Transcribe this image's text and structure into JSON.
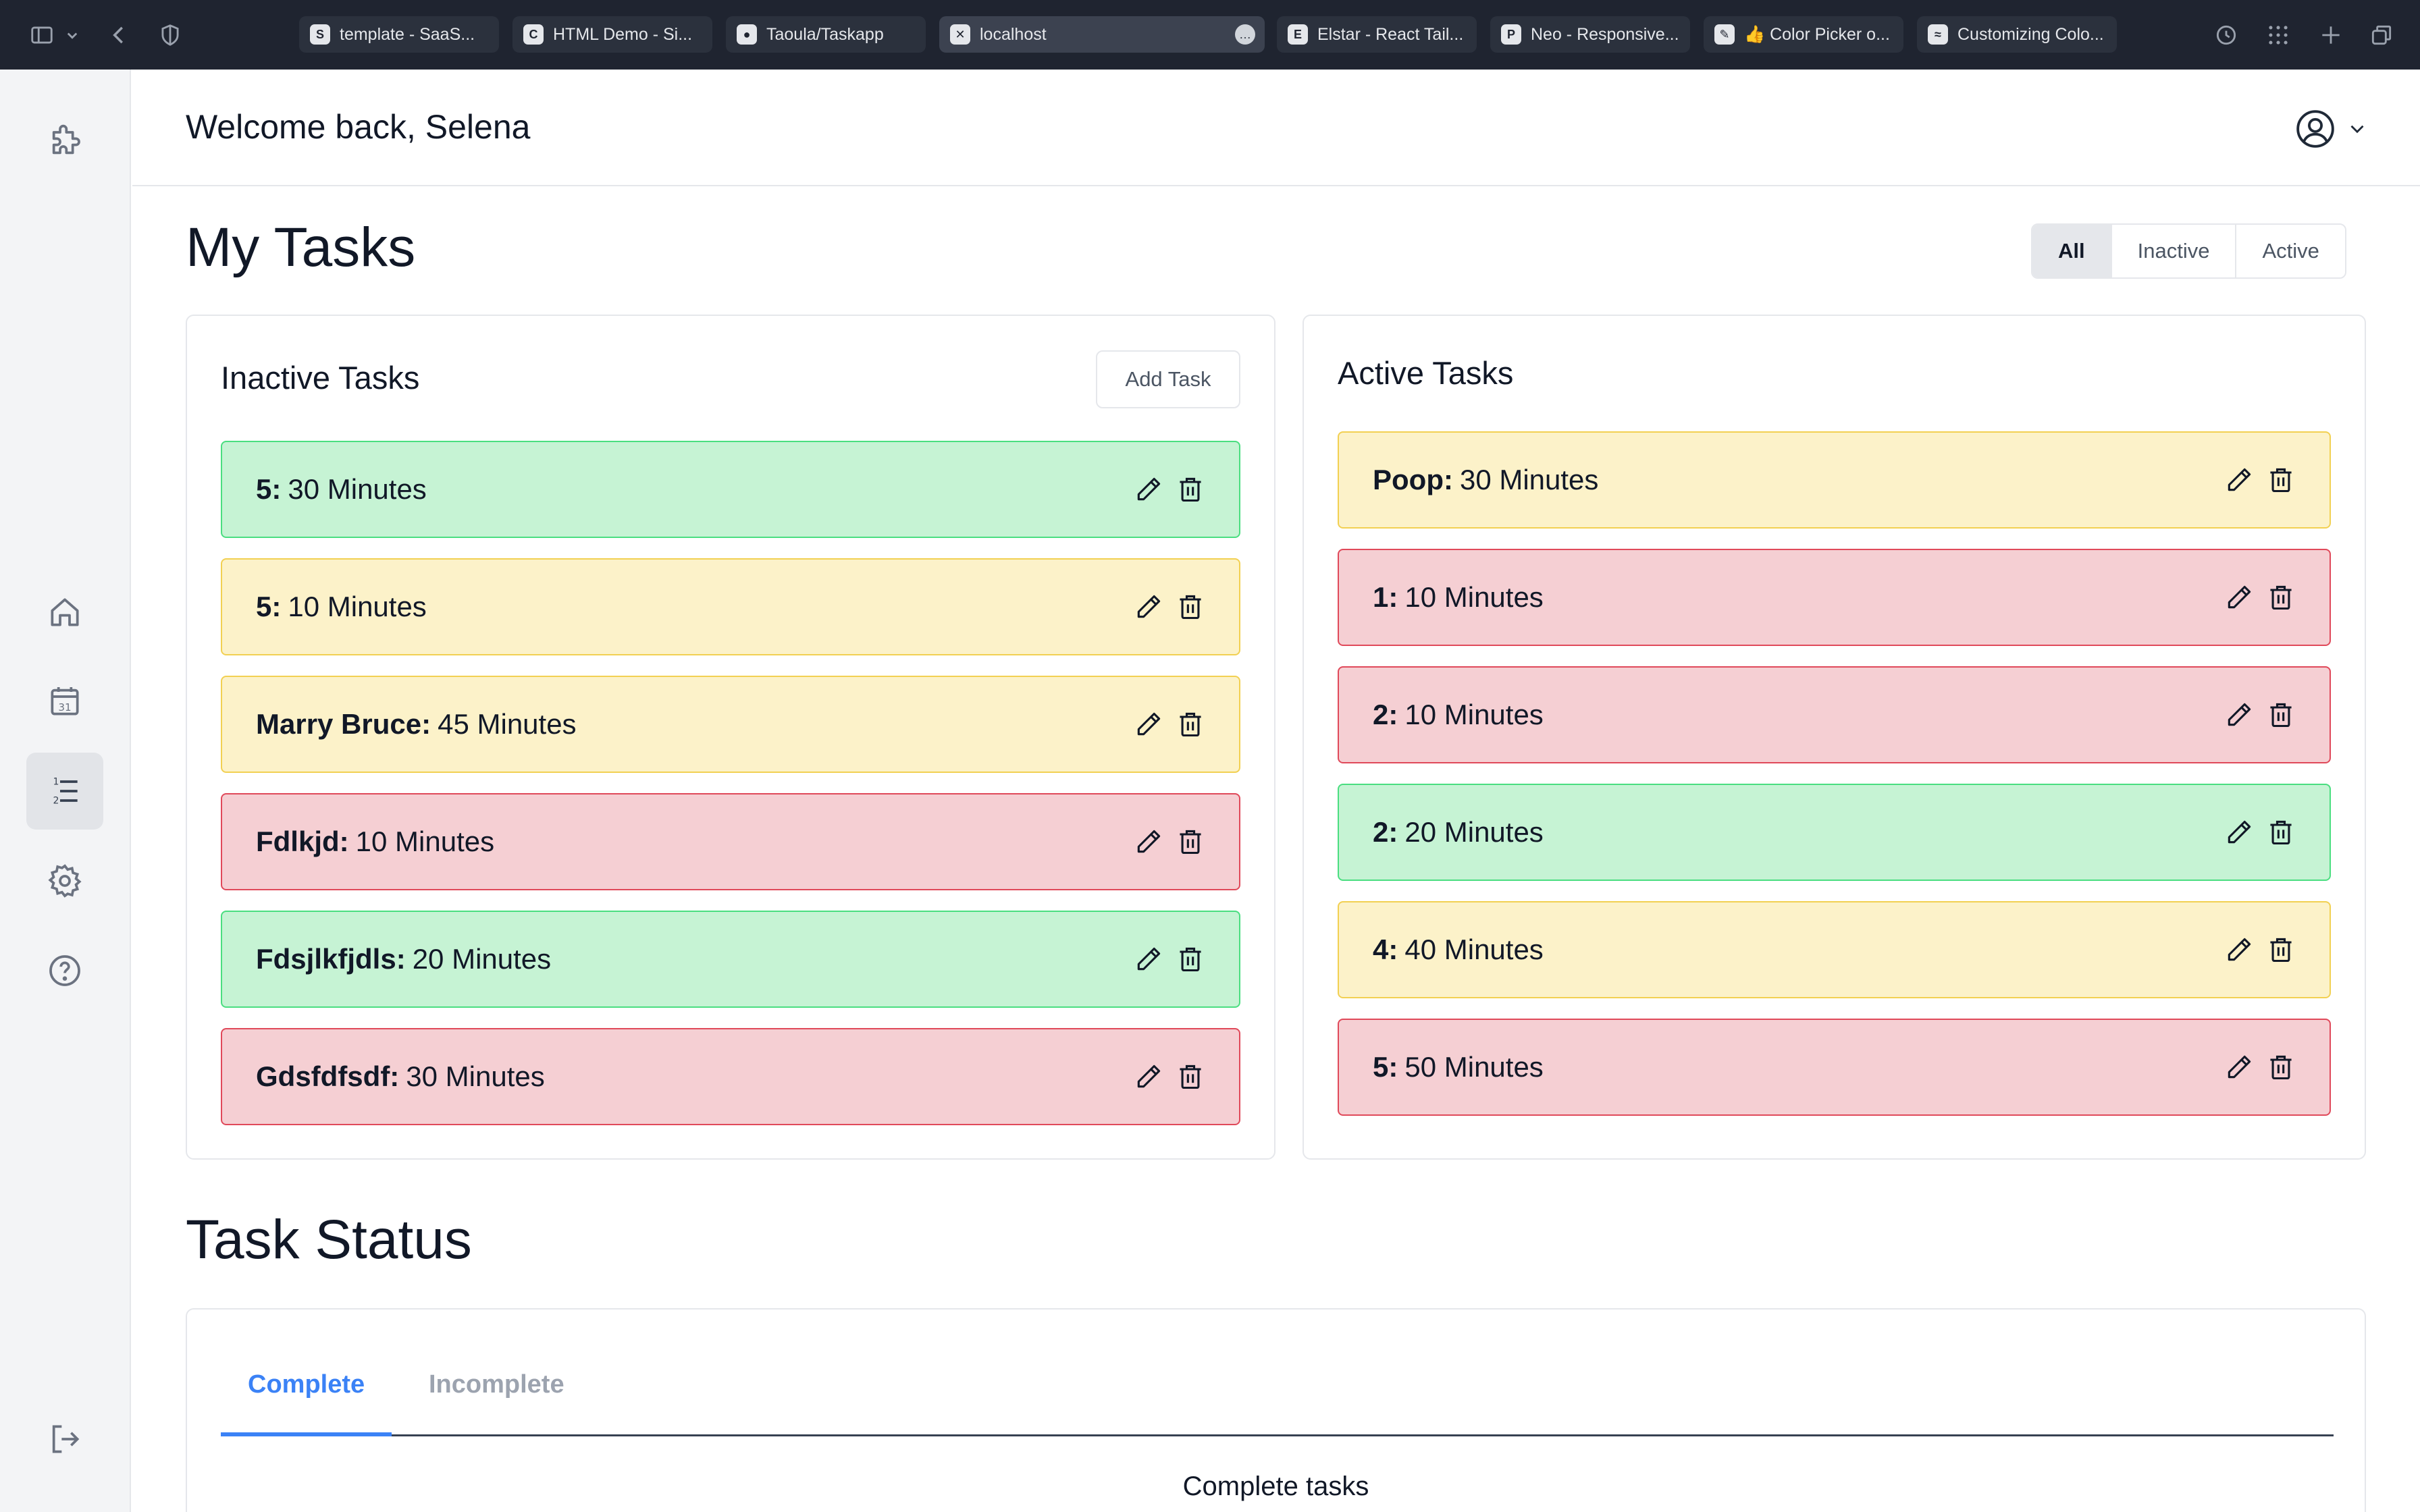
{
  "browser": {
    "tabs": [
      {
        "label": "template - SaaS...",
        "favicon": "S",
        "active": false
      },
      {
        "label": "HTML Demo - Si...",
        "favicon": "C",
        "active": false
      },
      {
        "label": "Taoula/Taskapp",
        "favicon": "github",
        "active": false
      },
      {
        "label": "localhost",
        "favicon": "x",
        "active": true
      },
      {
        "label": "Elstar - React Tail...",
        "favicon": "E",
        "active": false
      },
      {
        "label": "Neo - Responsive...",
        "favicon": "P",
        "active": false
      },
      {
        "label": "👍 Color Picker o...",
        "favicon": "pen",
        "active": false
      },
      {
        "label": "Customizing Colo...",
        "favicon": "tailwind",
        "active": false
      }
    ]
  },
  "sidebar": {
    "items": [
      {
        "name": "puzzle-icon"
      },
      {
        "name": "home-icon"
      },
      {
        "name": "calendar-icon",
        "text": "31"
      },
      {
        "name": "list-icon",
        "selected": true
      },
      {
        "name": "gear-icon"
      },
      {
        "name": "help-icon"
      },
      {
        "name": "logout-icon"
      }
    ]
  },
  "header": {
    "welcome": "Welcome back, Selena"
  },
  "page": {
    "title": "My Tasks",
    "filters": [
      "All",
      "Inactive",
      "Active"
    ],
    "selected_filter": "All"
  },
  "inactive_panel": {
    "title": "Inactive Tasks",
    "add_label": "Add Task",
    "tasks": [
      {
        "name": "5:",
        "duration": "30 Minutes",
        "color": "green"
      },
      {
        "name": "5:",
        "duration": "10 Minutes",
        "color": "yellow"
      },
      {
        "name": "Marry Bruce:",
        "duration": "45 Minutes",
        "color": "yellow"
      },
      {
        "name": "Fdlkjd:",
        "duration": "10 Minutes",
        "color": "red"
      },
      {
        "name": "Fdsjlkfjdls:",
        "duration": "20 Minutes",
        "color": "green"
      },
      {
        "name": "Gdsfdfsdf:",
        "duration": "30 Minutes",
        "color": "red"
      }
    ]
  },
  "active_panel": {
    "title": "Active Tasks",
    "tasks": [
      {
        "name": "Poop:",
        "duration": "30 Minutes",
        "color": "yellow"
      },
      {
        "name": "1:",
        "duration": "10 Minutes",
        "color": "red"
      },
      {
        "name": "2:",
        "duration": "10 Minutes",
        "color": "red"
      },
      {
        "name": "2:",
        "duration": "20 Minutes",
        "color": "green"
      },
      {
        "name": "4:",
        "duration": "40 Minutes",
        "color": "yellow"
      },
      {
        "name": "5:",
        "duration": "50 Minutes",
        "color": "red"
      }
    ]
  },
  "task_status": {
    "title": "Task Status",
    "tabs": [
      "Complete",
      "Incomplete"
    ],
    "selected_tab": "Complete",
    "heading": "Complete tasks"
  },
  "colors": {
    "green": {
      "bg": "#c6f3d4",
      "border": "#4ade80"
    },
    "yellow": {
      "bg": "#fcf2c9",
      "border": "#f2d052"
    },
    "red": {
      "bg": "#f5cfd3",
      "border": "#e0495a"
    },
    "accent": "#3b82f6"
  }
}
